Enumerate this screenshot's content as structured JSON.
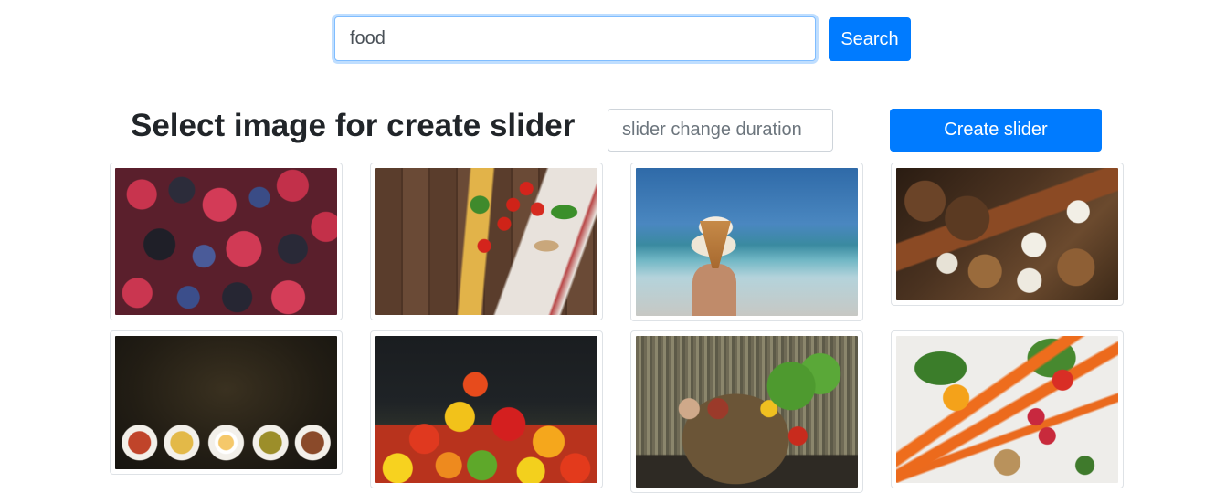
{
  "search": {
    "value": "food",
    "button_label": "Search"
  },
  "gallery": {
    "heading": "Select image for create slider",
    "duration_placeholder": "slider change duration",
    "create_button_label": "Create slider",
    "images": [
      {
        "icon": "berries-photo"
      },
      {
        "icon": "tomatoes-pasta-photo"
      },
      {
        "icon": "ice-cream-photo"
      },
      {
        "icon": "christmas-spices-photo"
      },
      {
        "icon": "plates-photo"
      },
      {
        "icon": "gummy-bears-photo"
      },
      {
        "icon": "vegetable-basket-photo"
      },
      {
        "icon": "vegetables-photo"
      }
    ]
  },
  "colors": {
    "primary": "#007bff",
    "text": "#212529",
    "border": "#dee2e6"
  }
}
